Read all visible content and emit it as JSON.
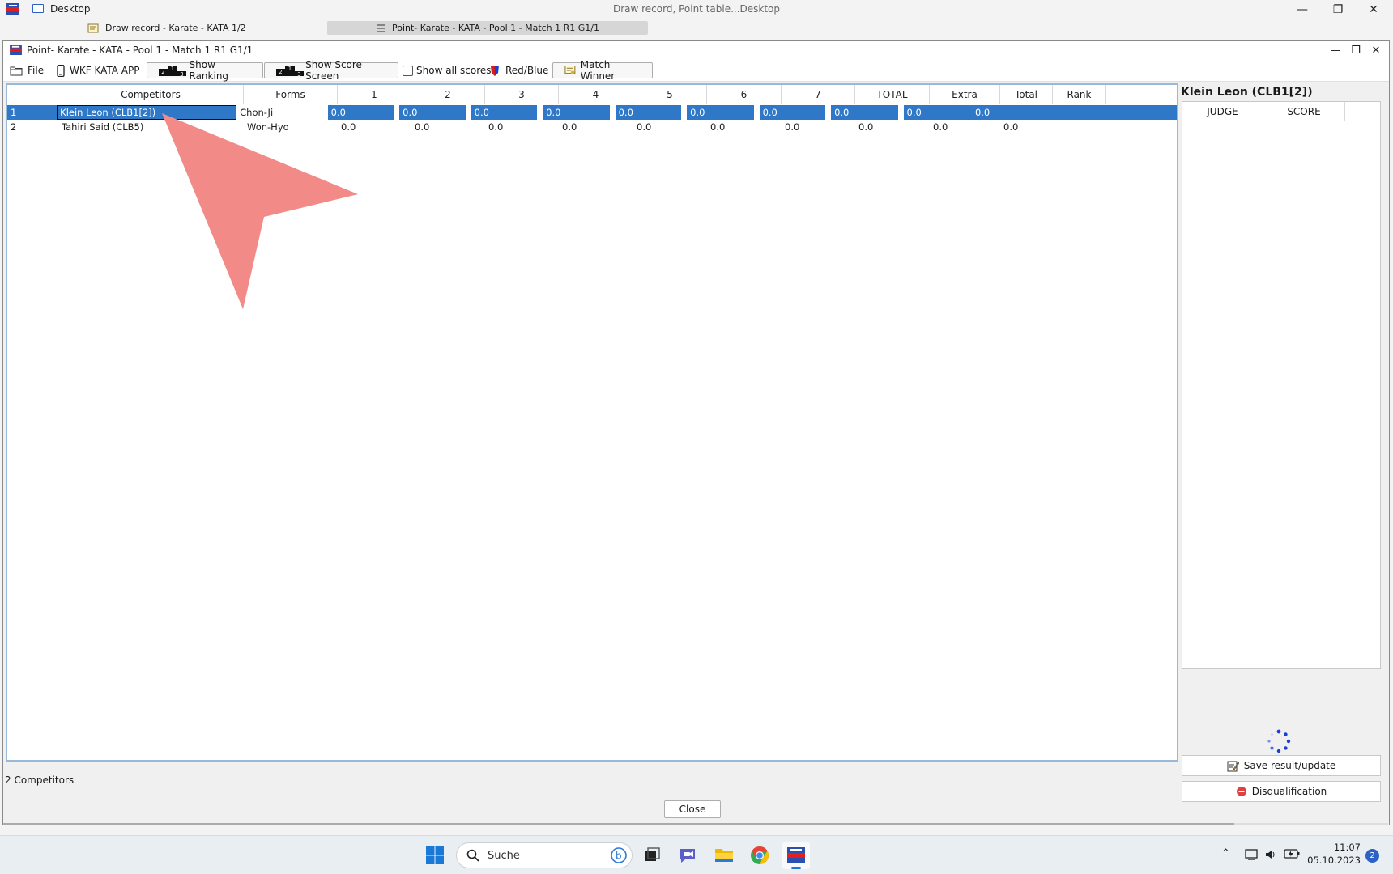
{
  "app_bar": {
    "desktop_label": "Desktop",
    "center_title": "Draw record, Point table...Desktop"
  },
  "mdi_tabs": [
    {
      "label": "Draw record - Karate - KATA 1/2",
      "active": false
    },
    {
      "label": "Point- Karate - KATA - Pool 1 - Match 1 R1 G1/1",
      "active": true
    }
  ],
  "window": {
    "title": "Point- Karate - KATA - Pool 1 - Match 1 R1 G1/1"
  },
  "toolbar": {
    "file": "File",
    "wkf_app": "WKF KATA APP",
    "show_ranking": "Show Ranking",
    "show_score_screen": "Show Score Screen",
    "show_all_scores": "Show all scores",
    "red_blue": "Red/Blue",
    "match_winner": "Match Winner"
  },
  "grid": {
    "columns": [
      "",
      "Competitors",
      "Forms",
      "1",
      "2",
      "3",
      "4",
      "5",
      "6",
      "7",
      "TOTAL",
      "Extra",
      "Total",
      "Rank"
    ],
    "rows": [
      {
        "num": "1",
        "competitor": "Klein Leon (CLB1[2])",
        "form": "Chon-Ji",
        "s1": "0.0",
        "s2": "0.0",
        "s3": "0.0",
        "s4": "0.0",
        "s5": "0.0",
        "s6": "0.0",
        "s7": "0.0",
        "total": "0.0",
        "extra": "0.0",
        "total2": "0.0",
        "rank": "",
        "selected": true
      },
      {
        "num": "2",
        "competitor": "Tahiri Said (CLB5)",
        "form": "Won-Hyo",
        "s1": "0.0",
        "s2": "0.0",
        "s3": "0.0",
        "s4": "0.0",
        "s5": "0.0",
        "s6": "0.0",
        "s7": "0.0",
        "total": "0.0",
        "extra": "0.0",
        "total2": "0.0",
        "rank": "",
        "selected": false
      }
    ]
  },
  "right_panel": {
    "competitor_name": "Klein Leon (CLB1[2])",
    "judge_header": "JUDGE",
    "score_header": "SCORE",
    "save_button": "Save result/update",
    "disqualification_button": "Disqualification"
  },
  "status": {
    "count": "2 Competitors",
    "close": "Close"
  },
  "taskbar": {
    "search_placeholder": "Suche",
    "time": "11:07",
    "date": "05.10.2023",
    "notifications": "2"
  },
  "colors": {
    "selection": "#2f78c8",
    "grid_border": "#98b9d9",
    "pointer_overlay": "#f28a88"
  }
}
